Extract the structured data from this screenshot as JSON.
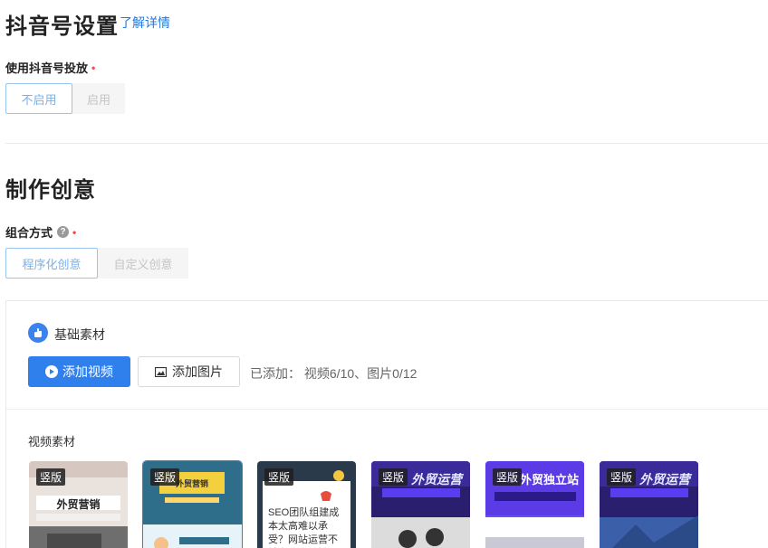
{
  "douyin": {
    "heading": "抖音号设置",
    "detail_link": "了解详情",
    "use_label": "使用抖音号投放",
    "required_mark": "•",
    "options": [
      "不启用",
      "启用"
    ]
  },
  "creative": {
    "heading": "制作创意",
    "combo_label": "组合方式",
    "help_glyph": "?",
    "required_mark": "•",
    "options": [
      "程序化创意",
      "自定义创意"
    ]
  },
  "materials": {
    "section_title": "基础素材",
    "add_video": "添加视频",
    "add_image": "添加图片",
    "added_status": "已添加： 视频6/10、图片0/12",
    "video_section_title": "视频素材",
    "thumbnails": [
      {
        "badge": "竖版",
        "caption": "外贸营销"
      },
      {
        "badge": "竖版",
        "caption": "外贸营销"
      },
      {
        "badge": "竖版",
        "caption": "SEO团队组建成本太高难以承受？网站运营不够专业，关键词排不上？"
      },
      {
        "badge": "竖版",
        "caption": "外贸运营"
      },
      {
        "badge": "竖版",
        "caption": "外贸独立站"
      },
      {
        "badge": "竖版",
        "caption": "外贸运营"
      }
    ]
  },
  "colors": {
    "primary": "#2f80ed",
    "link": "#1f7ae0",
    "required": "#f04b4b"
  }
}
